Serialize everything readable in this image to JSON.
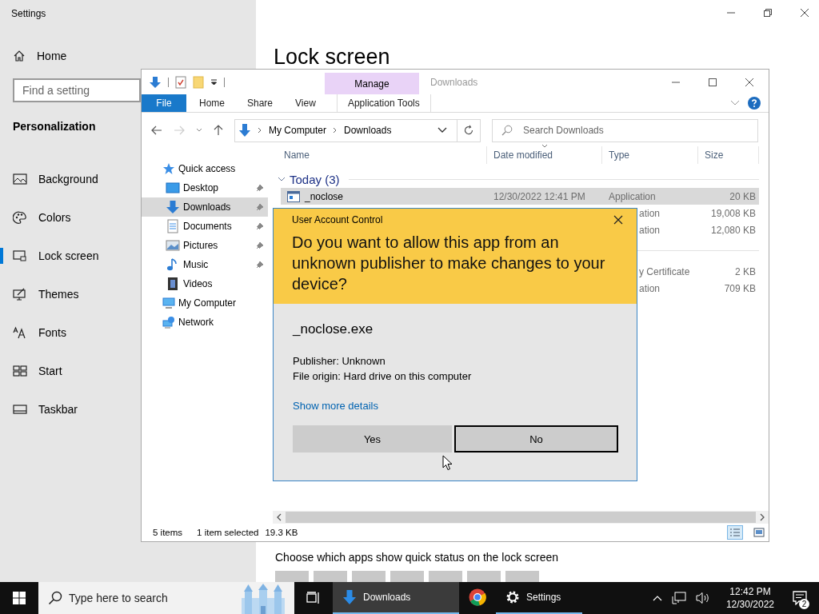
{
  "settings_window": {
    "title": "Settings",
    "home": "Home",
    "search": {
      "placeholder": "Find a setting"
    },
    "section": "Personalization",
    "nav": [
      {
        "label": "Background",
        "selected": false
      },
      {
        "label": "Colors",
        "selected": false
      },
      {
        "label": "Lock screen",
        "selected": true
      },
      {
        "label": "Themes",
        "selected": false
      },
      {
        "label": "Fonts",
        "selected": false
      },
      {
        "label": "Start",
        "selected": false
      },
      {
        "label": "Taskbar",
        "selected": false
      }
    ],
    "page_title": "Lock screen",
    "quick_status_label": "Choose which apps show quick status on the lock screen",
    "quick_status_apps": [
      {
        "kind": "empty"
      },
      {
        "kind": "empty"
      },
      {
        "kind": "empty"
      },
      {
        "kind": "empty"
      },
      {
        "kind": "empty"
      },
      {
        "kind": "empty"
      },
      {
        "kind": "empty"
      }
    ]
  },
  "explorer": {
    "context_tab": "Manage",
    "title": "Downloads",
    "ribbon_tabs": [
      {
        "label": "File",
        "kind": "file"
      },
      {
        "label": "Home",
        "kind": "tab"
      },
      {
        "label": "Share",
        "kind": "tab"
      },
      {
        "label": "View",
        "kind": "tab"
      },
      {
        "label": "Application Tools",
        "kind": "context"
      }
    ],
    "address": {
      "path": [
        "My Computer",
        "Downloads"
      ]
    },
    "search": {
      "placeholder": "Search Downloads"
    },
    "nav": [
      {
        "label": "Quick access",
        "children": [
          {
            "label": "Desktop",
            "pinned": true,
            "selected": false
          },
          {
            "label": "Downloads",
            "pinned": true,
            "selected": true
          },
          {
            "label": "Documents",
            "pinned": true,
            "selected": false
          },
          {
            "label": "Pictures",
            "pinned": true,
            "selected": false
          },
          {
            "label": "Music",
            "pinned": true,
            "selected": false
          },
          {
            "label": "Videos",
            "pinned": false,
            "selected": false
          }
        ]
      },
      {
        "label": "My Computer"
      },
      {
        "label": "Network"
      }
    ],
    "columns": [
      "Name",
      "Date modified",
      "Type",
      "Size"
    ],
    "groups": [
      {
        "label": "Today (3)",
        "expanded": true,
        "rows": [
          {
            "name": "_noclose",
            "date": "12/30/2022 12:41 PM",
            "type": "Application",
            "size": "20 KB",
            "selected": true
          },
          {
            "type": "ation",
            "size": "19,008 KB",
            "selected": false
          },
          {
            "type": "ation",
            "size": "12,080 KB",
            "selected": false
          }
        ]
      },
      {
        "rows": [
          {
            "type": "y Certificate",
            "size": "2 KB",
            "selected": false
          },
          {
            "type": "ation",
            "size": "709 KB",
            "selected": false
          }
        ]
      }
    ],
    "status": {
      "items": "5 items",
      "selection": "1 item selected",
      "size": "19.3 KB"
    },
    "views": [
      {
        "kind": "details",
        "selected": true
      },
      {
        "kind": "thumbnails",
        "selected": false
      }
    ]
  },
  "uac": {
    "title": "User Account Control",
    "question": "Do you want to allow this app from an unknown publisher to make changes to your device?",
    "program": "_noclose.exe",
    "details": [
      "Publisher: Unknown",
      "File origin: Hard drive on this computer"
    ],
    "link": "Show more details",
    "buttons": [
      {
        "label": "Yes",
        "focused": false
      },
      {
        "label": "No",
        "focused": true
      }
    ]
  },
  "taskbar": {
    "search_placeholder": "Type here to search",
    "apps": [
      {
        "kind": "explorer",
        "label": "Downloads",
        "open": true,
        "active": true
      },
      {
        "kind": "browser",
        "open": false,
        "active": false
      },
      {
        "kind": "settings",
        "label": "Settings",
        "open": true,
        "active": false
      }
    ],
    "clock": {
      "time": "12:42 PM",
      "date": "12/30/2022"
    },
    "notifications": "2"
  }
}
